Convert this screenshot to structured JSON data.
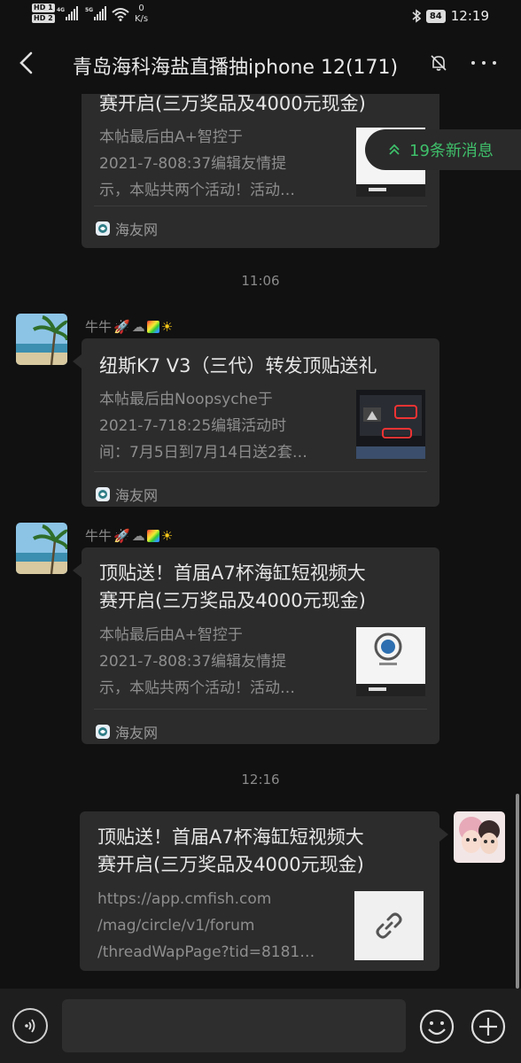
{
  "status_bar": {
    "hd1": "HD 1",
    "hd2": "HD 2",
    "net1": "4G",
    "net2": "5G",
    "speed_value": "0",
    "speed_unit": "K/s",
    "battery": "84",
    "time": "12:19"
  },
  "header": {
    "back_icon": "chevron-left-icon",
    "title": "青岛海科海盐直播抽iphone 12(171)",
    "mute_icon": "bell-off-icon",
    "more_icon": "more-icon"
  },
  "new_messages": {
    "icon": "double-chevron-up-icon",
    "label": "19条新消息"
  },
  "messages": [
    {
      "title_lines": [
        "赛开启(三万奖品及4000元现金)"
      ],
      "desc_lines": [
        "本帖最后由A+智控于",
        "2021-7-808:37编辑友情提",
        "示，本贴共两个活动！活动…"
      ],
      "source": "海友网"
    },
    {
      "sender": "牛牛",
      "title_lines": [
        "纽斯K7 V3（三代）转发顶贴送礼"
      ],
      "desc_lines": [
        "本帖最后由Noopsyche于",
        "2021-7-718:25编辑活动时",
        "间：7月5日到7月14日送2套…"
      ],
      "source": "海友网"
    },
    {
      "sender": "牛牛",
      "title_lines": [
        "顶贴送！首届A7杯海缸短视频大",
        "赛开启(三万奖品及4000元现金)"
      ],
      "desc_lines": [
        "本帖最后由A+智控于",
        "2021-7-808:37编辑友情提",
        "示，本贴共两个活动！活动…"
      ],
      "source": "海友网"
    },
    {
      "title_lines": [
        "顶贴送！首届A7杯海缸短视频大",
        "赛开启(三万奖品及4000元现金)"
      ],
      "desc_lines": [
        "https://app.cmfish.com",
        "/mag/circle/v1/forum",
        "/threadWapPage?tid=8181…"
      ],
      "link_icon": "link-icon"
    }
  ],
  "timestamps": [
    "11:06",
    "12:16"
  ],
  "input_bar": {
    "voice_icon": "voice-icon",
    "emoji_icon": "emoji-icon",
    "plus_icon": "plus-icon"
  }
}
